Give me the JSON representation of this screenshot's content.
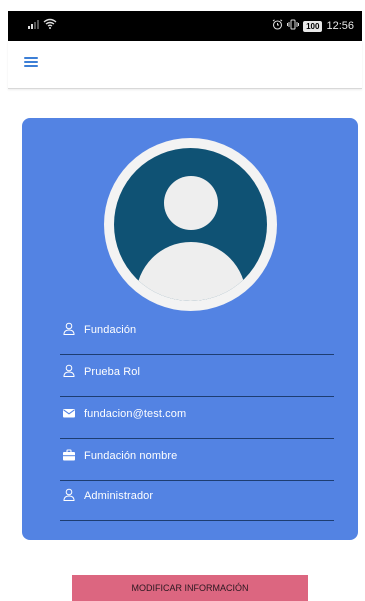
{
  "status_bar": {
    "time": "12:56",
    "battery": "100"
  },
  "top_bar": {
    "menu_icon": "hamburger-menu-icon"
  },
  "profile": {
    "fields": [
      {
        "icon": "user-icon",
        "value": "Fundación"
      },
      {
        "icon": "user-icon",
        "value": "Prueba Rol"
      },
      {
        "icon": "mail-icon",
        "value": "fundacion@test.com"
      },
      {
        "icon": "briefcase-icon",
        "value": "Fundación nombre"
      },
      {
        "icon": "user-icon",
        "value": "Administrador"
      }
    ]
  },
  "actions": {
    "edit_label": "MODIFICAR INFORMACIÓN"
  },
  "colors": {
    "card": "#5383e3",
    "avatar": "#0f5274",
    "button": "#dc6680",
    "menu": "#3d7fd6"
  }
}
